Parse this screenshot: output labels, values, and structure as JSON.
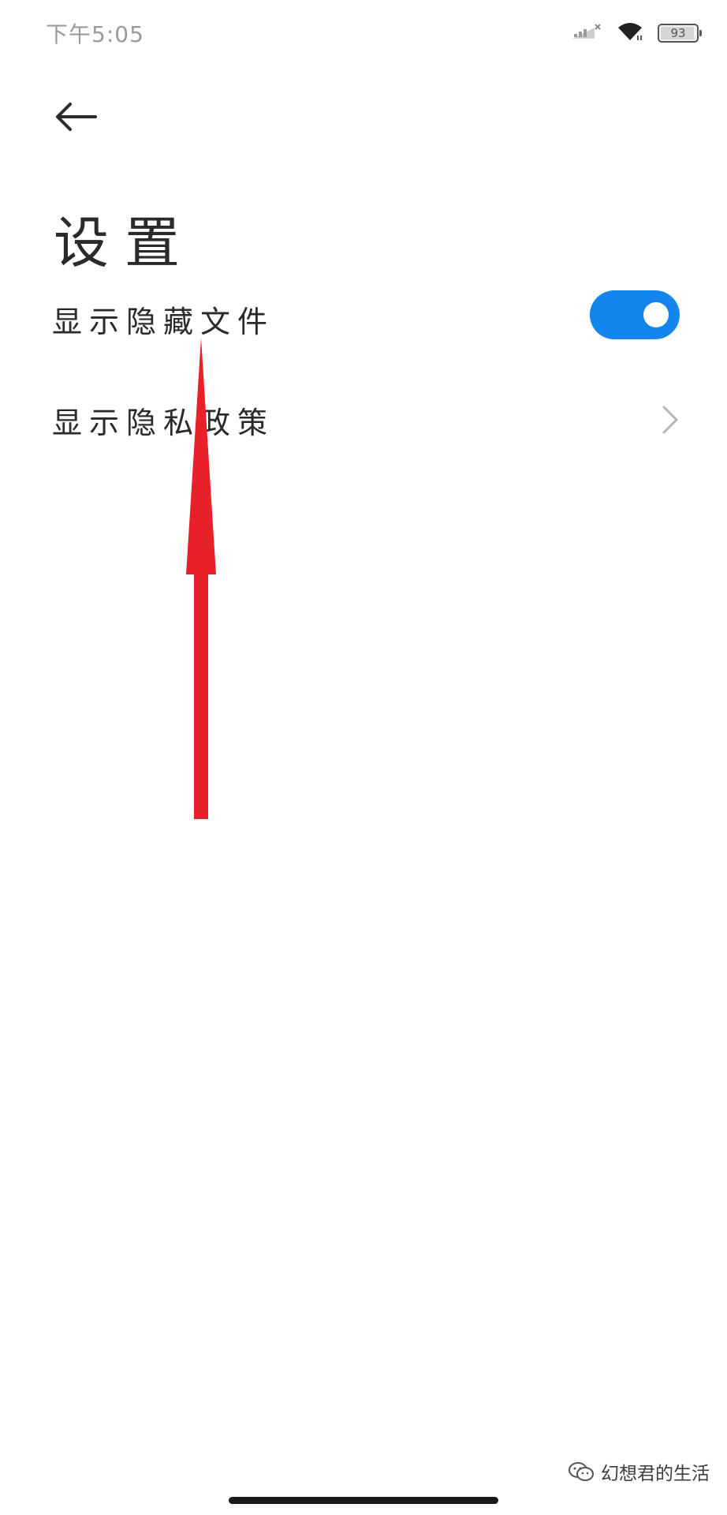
{
  "status_bar": {
    "time": "下午5:05",
    "battery_level": "93"
  },
  "header": {
    "title": "设置"
  },
  "settings": {
    "items": [
      {
        "label": "显示隐藏文件",
        "control": "toggle",
        "on": true
      },
      {
        "label": "显示隐私政策",
        "control": "chevron"
      }
    ]
  },
  "watermark": {
    "text": "幻想君的生活"
  },
  "colors": {
    "toggle_on": "#1485ee",
    "annotation_arrow": "#e8202a"
  },
  "icons": [
    "signal-icon",
    "wifi-icon",
    "battery-icon",
    "back-arrow-icon",
    "chevron-right-icon",
    "wechat-icon"
  ]
}
